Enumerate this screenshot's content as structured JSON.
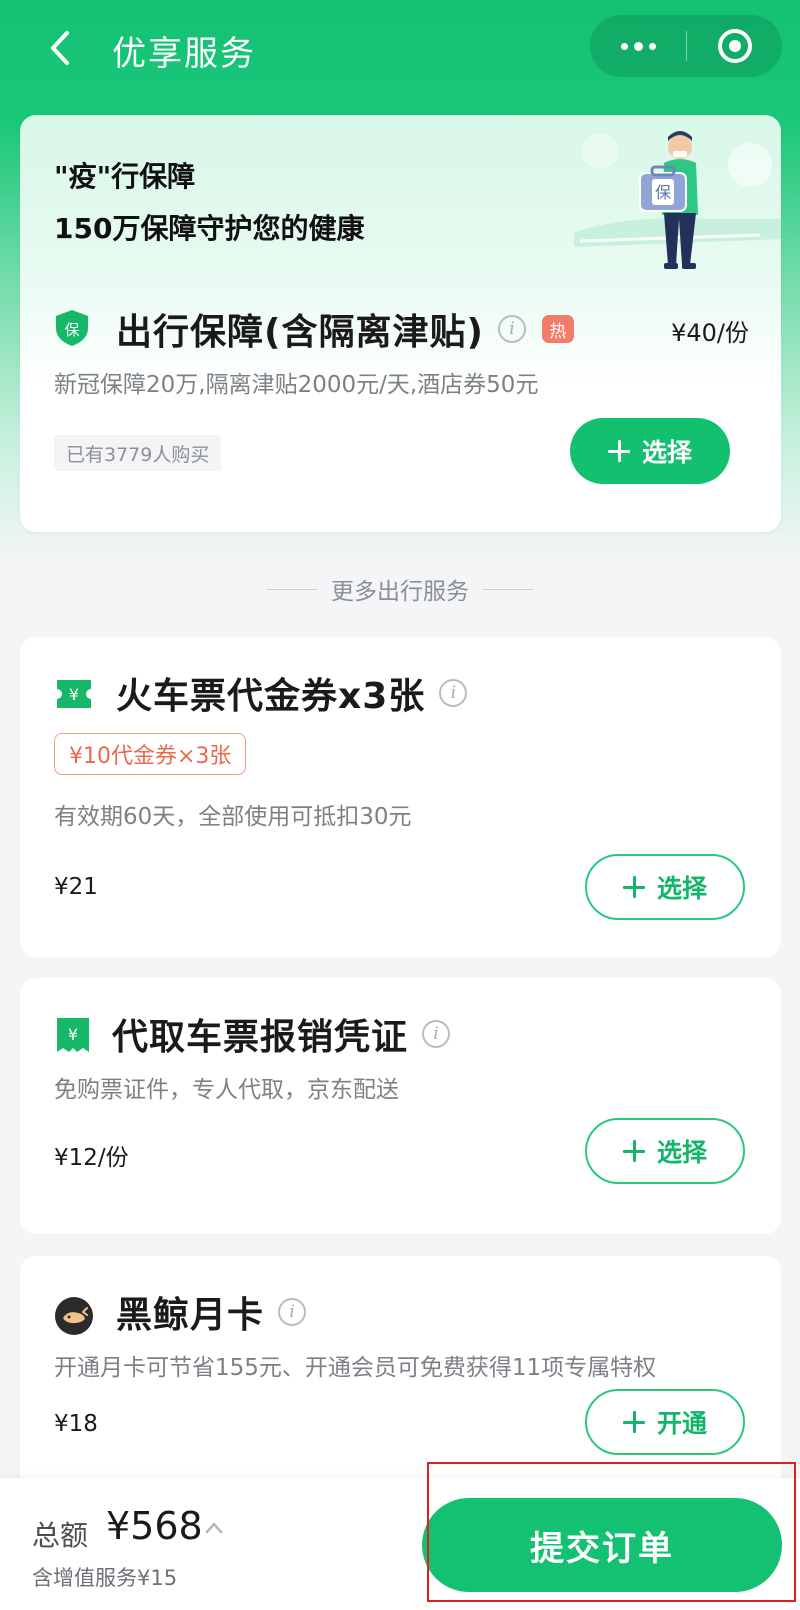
{
  "header": {
    "title": "优享服务",
    "back_icon": "chevron-left-icon",
    "more_icon": "more-dots-icon",
    "close_icon": "capsule-close-icon"
  },
  "hero": {
    "title": "\"疫\"行保障",
    "subtitle": "150万保障守护您的健康",
    "illustration": "person-holding-insurance-case",
    "illustration_badge": "保",
    "product": {
      "icon": "shield-icon",
      "icon_text": "保",
      "name": "出行保障(含隔离津贴)",
      "info_icon": "info-icon",
      "hot_badge": "热",
      "price": "¥40/份",
      "description": "新冠保障20万,隔离津贴2000元/天,酒店券50元",
      "sold": "已有3779人购买",
      "button_label": "选择"
    }
  },
  "divider": {
    "label": "更多出行服务"
  },
  "services": [
    {
      "icon": "ticket-coupon-icon",
      "name": "火车票代金券x3张",
      "tag": "¥10代金券×3张",
      "description": "有效期60天，全部使用可抵扣30元",
      "price": "¥21",
      "button_label": "选择"
    },
    {
      "icon": "receipt-icon",
      "name": "代取车票报销凭证",
      "description": "免购票证件，专人代取，京东配送",
      "price": "¥12/份",
      "button_label": "选择"
    },
    {
      "icon": "black-whale-icon",
      "name": "黑鲸月卡",
      "description": "开通月卡可节省155元、开通会员可免费获得11项专属特权",
      "price": "¥18",
      "button_label": "开通"
    }
  ],
  "footer": {
    "total_label": "总额",
    "total_amount": "¥568",
    "value_added_note": "含增值服务¥15",
    "submit_label": "提交订单"
  },
  "colors": {
    "brand_green": "#13c06f",
    "hot_badge": "#f27b6a",
    "coupon_tag": "#eb6a4f",
    "highlight": "#e01e1e"
  }
}
